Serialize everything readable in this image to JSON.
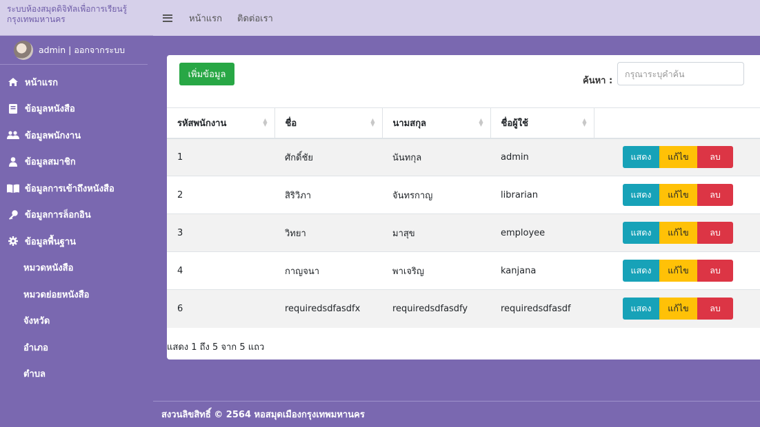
{
  "brand": {
    "title": "ระบบห้องสมุดดิจิทัลเพื่อการเรียนรู้ กรุงเทพมหานคร"
  },
  "user": {
    "label": "admin | ออกจากระบบ"
  },
  "sidebar": {
    "items": [
      {
        "label": "หน้าแรก",
        "icon": "home-icon"
      },
      {
        "label": "ข้อมูลหนังสือ",
        "icon": "book-icon"
      },
      {
        "label": "ข้อมูลพนักงาน",
        "icon": "users-icon"
      },
      {
        "label": "ข้อมูลสมาชิก",
        "icon": "user-icon"
      },
      {
        "label": "ข้อมูลการเข้าถึงหนังสือ",
        "icon": "book-open-icon"
      },
      {
        "label": "ข้อมูลการล็อกอิน",
        "icon": "key-icon"
      },
      {
        "label": "ข้อมูลพื้นฐาน",
        "icon": "gear-icon"
      }
    ],
    "subitems": [
      "หมวดหนังสือ",
      "หมวดย่อยหนังสือ",
      "จังหวัด",
      "อำเภอ",
      "ตำบล"
    ]
  },
  "topbar": {
    "links": [
      "หน้าแรก",
      "ติดต่อเรา"
    ]
  },
  "toolbar": {
    "add_label": "เพิ่มข้อมูล",
    "search_label": "ค้นหา :",
    "search_placeholder": "กรุณาระบุคำค้น"
  },
  "table": {
    "columns": [
      "รหัสพนักงาน",
      "ชื่อ",
      "นามสกุล",
      "ชื่อผู้ใช้",
      ""
    ],
    "rows": [
      [
        "1",
        "ศักดิ์ชัย",
        "นันทกุล",
        "admin"
      ],
      [
        "2",
        "สิริวิภา",
        "จันทรกาญ",
        "librarian"
      ],
      [
        "3",
        "วิทยา",
        "มาสุข",
        "employee"
      ],
      [
        "4",
        "กาญจนา",
        "พาเจริญ",
        "kanjana"
      ],
      [
        "6",
        "requiredsdfasdfx",
        "requiredsdfasdfy",
        "requiredsdfasdf"
      ]
    ],
    "actions": {
      "show": "แสดง",
      "edit": "แก้ไข",
      "delete": "ลบ"
    },
    "info": "แสดง 1 ถึง 5 จาก 5 แถว"
  },
  "footer": {
    "text": "สงวนลิขสิทธิ์ © 2564 หอสมุดเมืองกรุงเทพมหานคร"
  },
  "colors": {
    "sidebar": "#7a68b0",
    "topbar": "#d6d0ea",
    "success": "#28a745",
    "info": "#17a2b8",
    "warning": "#ffc107",
    "danger": "#dc3545"
  }
}
